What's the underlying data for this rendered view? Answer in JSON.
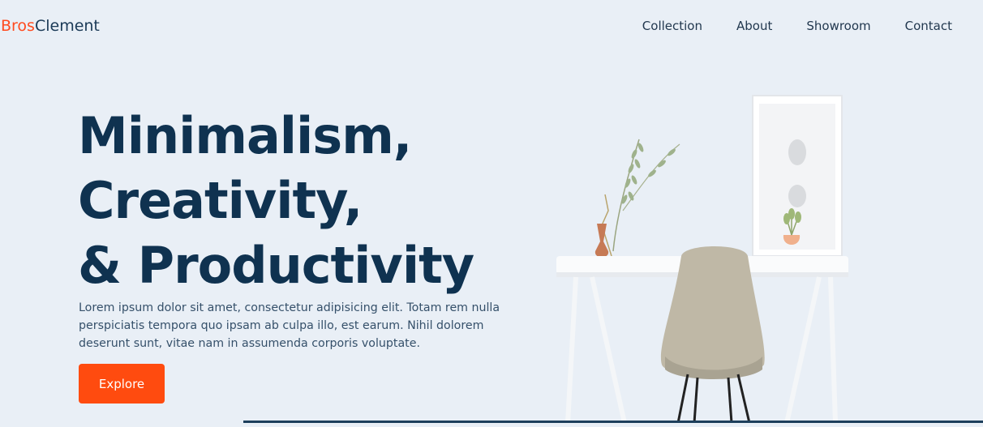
{
  "header": {
    "logo_accent": "Bros",
    "logo_rest": "Clement",
    "nav": [
      {
        "label": "Collection"
      },
      {
        "label": "About"
      },
      {
        "label": "Showroom"
      },
      {
        "label": "Contact"
      }
    ]
  },
  "hero": {
    "title_lines": [
      "Minimalism,",
      "Creativity,",
      "& Productivity"
    ],
    "description": "Lorem ipsum dolor sit amet, consectetur adipisicing elit. Totam rem nulla perspiciatis tempora quo ipsam ab culpa illo, est earum. Nihil dolorem deserunt sunt, vitae nam in assumenda corporis voluptate.",
    "cta_label": "Explore"
  },
  "colors": {
    "accent": "#ff4b1f",
    "primary_text": "#0f3250",
    "background": "#e9eff6"
  }
}
